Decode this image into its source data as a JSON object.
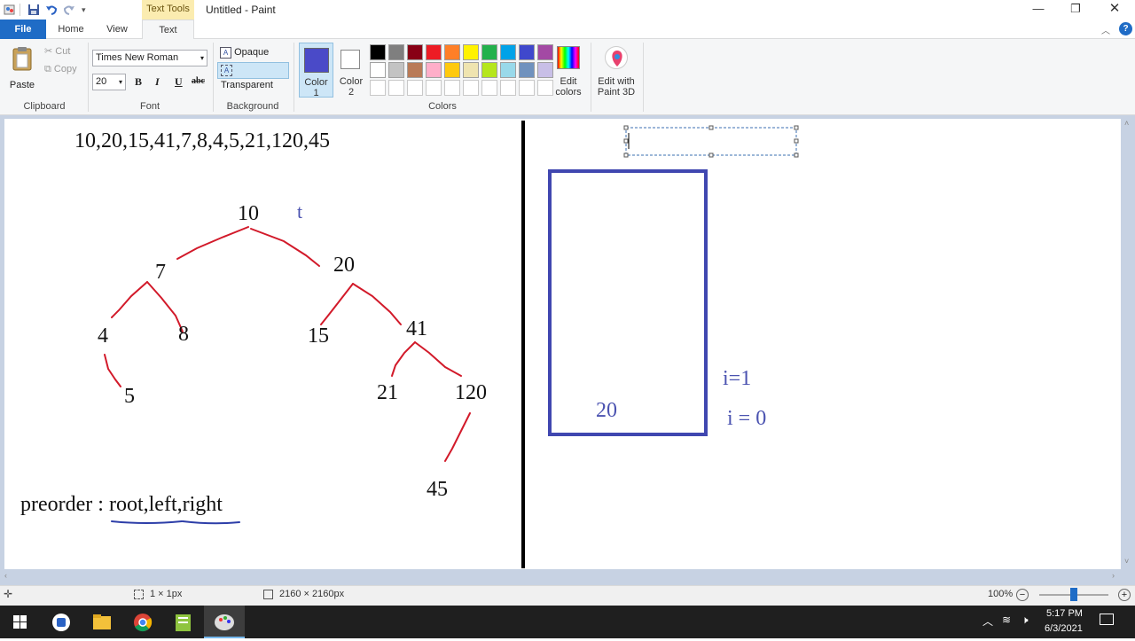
{
  "window": {
    "title": "Untitled - Paint",
    "context_tab": "Text Tools"
  },
  "tabs": [
    {
      "label": "File"
    },
    {
      "label": "Home"
    },
    {
      "label": "View"
    },
    {
      "label": "Text"
    }
  ],
  "clipboard": {
    "paste": "Paste",
    "cut": "Cut",
    "copy": "Copy",
    "group": "Clipboard"
  },
  "font": {
    "family": "Times New Roman",
    "size": "20",
    "bold": "B",
    "italic": "I",
    "underline": "U",
    "strike": "abc",
    "group": "Font"
  },
  "background": {
    "opaque": "Opaque",
    "transparent": "Transparent",
    "group": "Background"
  },
  "colors": {
    "color1_label": "Color",
    "color1_num": "1",
    "color2_label": "Color",
    "color2_num": "2",
    "color1_value": "#4a4ac8",
    "color2_value": "#ffffff",
    "edit_line1": "Edit",
    "edit_line2": "colors",
    "group": "Colors",
    "palette_row1": [
      "#000000",
      "#7f7f7f",
      "#880015",
      "#ed1c24",
      "#ff7f27",
      "#fff200",
      "#22b14c",
      "#00a2e8",
      "#3f48cc",
      "#a349a4"
    ],
    "palette_row2": [
      "#ffffff",
      "#c3c3c3",
      "#b97a57",
      "#ffaec9",
      "#ffc90e",
      "#efe4b0",
      "#b5e61d",
      "#99d9ea",
      "#7092be",
      "#c8bfe7"
    ]
  },
  "paint3d": {
    "line1": "Edit with",
    "line2": "Paint 3D"
  },
  "canvas_text": {
    "sequence": "10,20,15,41,7,8,4,5,21,120,45",
    "n10": "10",
    "t": "t",
    "n7": "7",
    "n20": "20",
    "n4": "4",
    "n8": "8",
    "n15": "15",
    "n41": "41",
    "n5": "5",
    "n21": "21",
    "n120": "120",
    "n45": "45",
    "preorder_prefix": "preorder : ",
    "preorder_root": "root",
    "preorder_left": ",left,",
    "preorder_right": "right",
    "stack_value": "20",
    "i1": "i=1",
    "i0": "i = 0"
  },
  "status": {
    "selection": "1 × 1px",
    "image_size": "2160 × 2160px",
    "zoom": "100%",
    "zoom_level": 0.5
  },
  "taskbar": {
    "time": "5:17 PM",
    "date": "6/3/2021"
  }
}
